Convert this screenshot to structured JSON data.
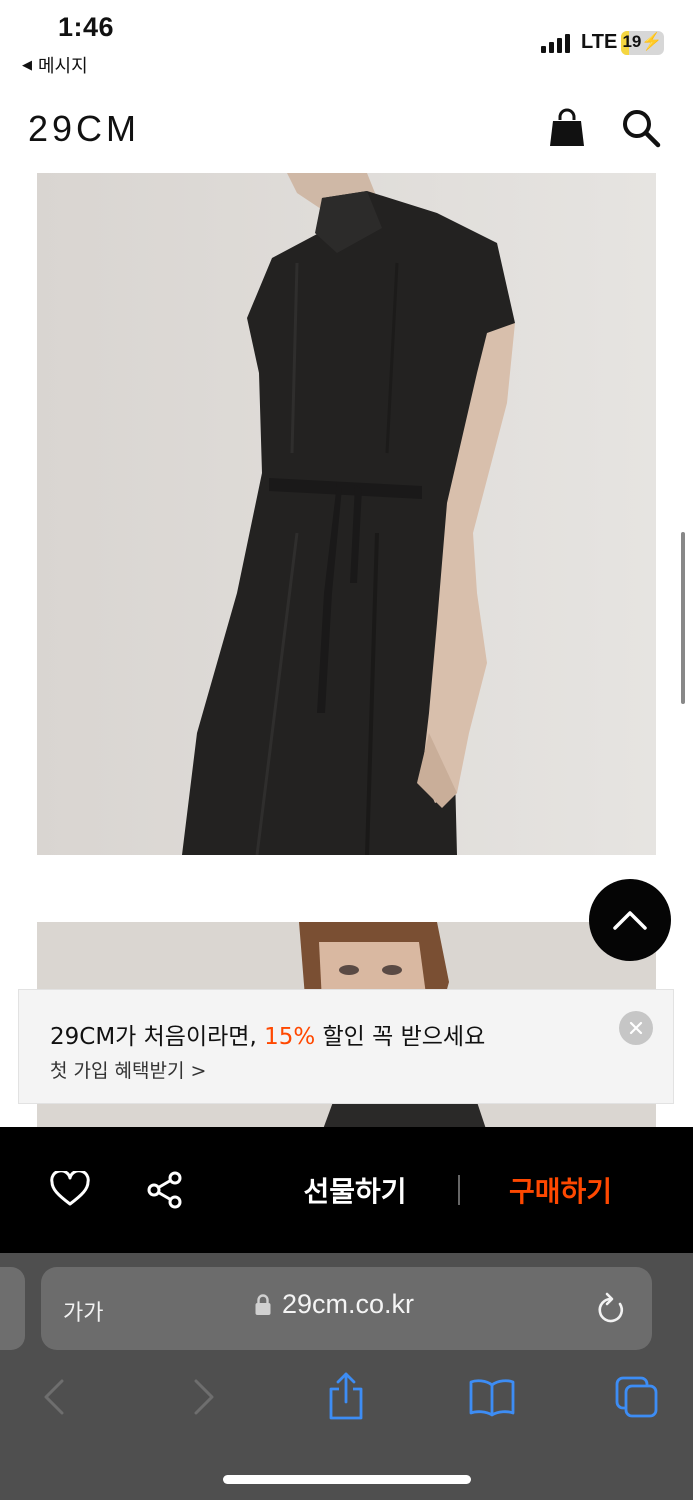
{
  "status_bar": {
    "time": "1:46",
    "back_label": "메시지",
    "network": "LTE",
    "battery": "19",
    "battery_level_percent": 19
  },
  "header": {
    "logo": "29CM",
    "icons": [
      "shopping-bag-icon",
      "search-icon"
    ]
  },
  "promo": {
    "title_before": "29CM가 처음이라면, ",
    "title_accent": "15%",
    "title_after": " 할인 꼭 받으세요",
    "subtitle": "첫 가입 혜택받기 >",
    "accent_color": "#ff4800"
  },
  "action_bar": {
    "gift_label": "선물하기",
    "buy_label": "구매하기",
    "buy_color": "#ff4800"
  },
  "safari": {
    "text_size_label": "가가",
    "url": "29cm.co.kr"
  }
}
